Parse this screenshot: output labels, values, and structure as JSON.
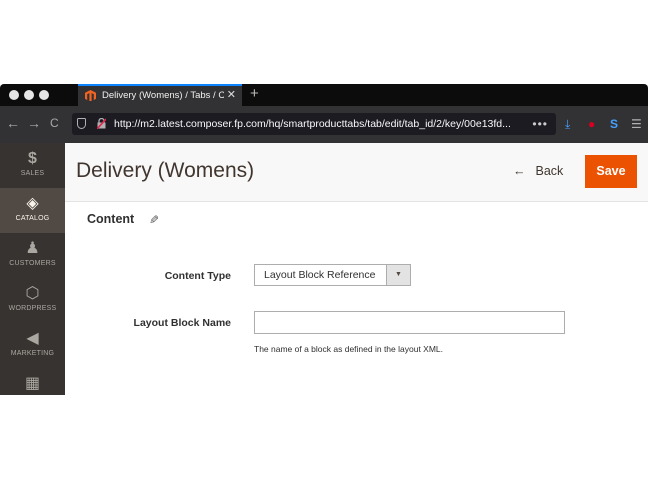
{
  "browser": {
    "tab_title": "Delivery (Womens) / Tabs / Cat...",
    "tab_close": "✕",
    "new_tab": "+",
    "url": "http://m2.latest.composer.fp.com/hq/smartproducttabs/tab/edit/tab_id/2/key/00e13fd...",
    "page_actions": "•••",
    "nav": {
      "back": "←",
      "forward": "→",
      "reload": "C"
    },
    "extensions": {
      "download": "⤓",
      "ext_red": "●",
      "ext_blue": "S",
      "menu": "☰"
    }
  },
  "sidebar": {
    "items": [
      {
        "label": "SALES",
        "icon": "$",
        "active": false
      },
      {
        "label": "CATALOG",
        "icon": "◈",
        "active": true
      },
      {
        "label": "CUSTOMERS",
        "icon": "♟",
        "active": false
      },
      {
        "label": "WORDPRESS",
        "icon": "⬡",
        "active": false
      },
      {
        "label": "MARKETING",
        "icon": "◀",
        "active": false
      },
      {
        "label": "",
        "icon": "▦",
        "active": false
      }
    ]
  },
  "page": {
    "title": "Delivery (Womens)",
    "back_label": "Back",
    "back_arrow": "←",
    "save_label": "Save"
  },
  "content": {
    "section_title": "Content",
    "content_type_label": "Content Type",
    "content_type_value": "Layout Block Reference",
    "layout_block_name_label": "Layout Block Name",
    "layout_block_name_value": "",
    "layout_block_note": "The name of a block as defined in the layout XML."
  },
  "colors": {
    "accent": "#eb5202",
    "sidebar_bg": "#373330",
    "sidebar_active": "#514943",
    "tab_highlight": "#0a84ff"
  }
}
